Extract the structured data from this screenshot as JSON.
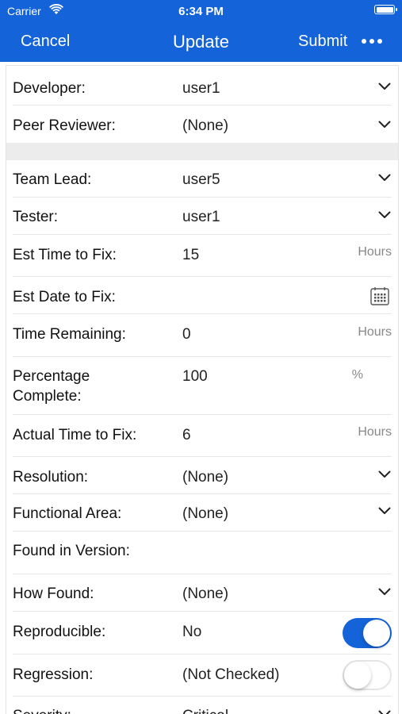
{
  "status_bar": {
    "carrier": "Carrier",
    "time": "6:34 PM"
  },
  "nav": {
    "cancel": "Cancel",
    "title": "Update",
    "submit": "Submit",
    "more_icon": "ellipsis-icon"
  },
  "colors": {
    "accent": "#1463d9",
    "section_gap": "#ececec",
    "unit_text": "#888888"
  },
  "group1": [
    {
      "label": "Developer:",
      "value": "user1",
      "control": "chevron"
    },
    {
      "label": "Peer Reviewer:",
      "value": "(None)",
      "control": "chevron"
    }
  ],
  "group2": [
    {
      "label": "Team Lead:",
      "value": "user5",
      "control": "chevron"
    },
    {
      "label": "Tester:",
      "value": "user1",
      "control": "chevron"
    },
    {
      "label": "Est Time to Fix:",
      "value": "15",
      "unit": "Hours"
    },
    {
      "label": "Est Date to Fix:",
      "value": "",
      "control": "calendar"
    },
    {
      "label": "Time Remaining:",
      "value": "0",
      "unit": "Hours"
    },
    {
      "label_line1": "Percentage",
      "label_line2": "Complete:",
      "value": "100",
      "unit": "%"
    },
    {
      "label": "Actual Time to Fix:",
      "value": "6",
      "unit": "Hours"
    },
    {
      "label": "Resolution:",
      "value": "(None)",
      "control": "chevron"
    },
    {
      "label": "Functional Area:",
      "value": "(None)",
      "control": "chevron"
    },
    {
      "label": "Found in Version:",
      "value": ""
    },
    {
      "label": "How Found:",
      "value": "(None)",
      "control": "chevron"
    },
    {
      "label": "Reproducible:",
      "value": "No",
      "toggle": true
    },
    {
      "label": "Regression:",
      "value": "(Not Checked)",
      "toggle": false
    },
    {
      "label": "Severity:",
      "value": "Critical",
      "control": "chevron"
    }
  ]
}
